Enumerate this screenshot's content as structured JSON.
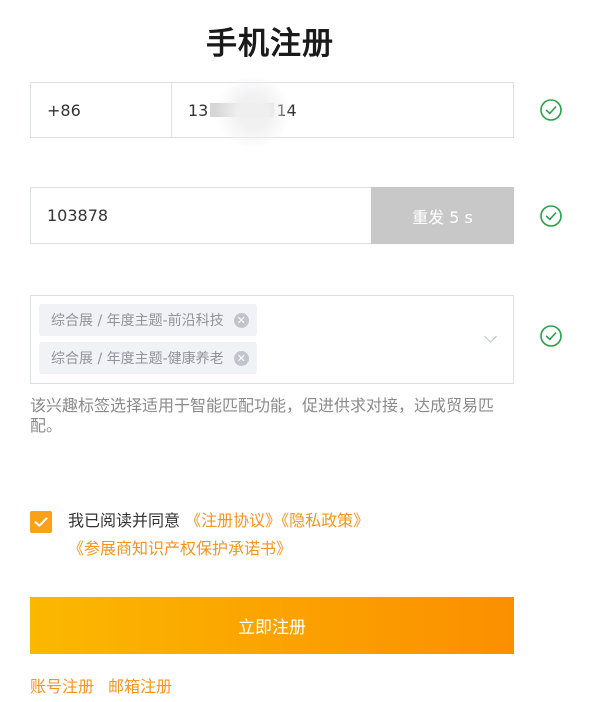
{
  "page": {
    "title": "手机注册"
  },
  "phone": {
    "country_code": "+86",
    "number_prefix": "13",
    "number_suffix": "14"
  },
  "verification": {
    "code_value": "103878",
    "resend_label": "重发 5 s"
  },
  "interests": {
    "tags": [
      "综合展 / 年度主题-前沿科技",
      "综合展 / 年度主题-健康养老"
    ],
    "hint": "该兴趣标签选择适用于智能匹配功能，促进供求对接，达成贸易匹配。"
  },
  "agreement": {
    "checked": true,
    "text": "我已阅读并同意",
    "terms_link": "《注册协议》",
    "privacy_link": "《隐私政策》",
    "exhibitor_link": "《参展商知识产权保护承诺书》"
  },
  "actions": {
    "submit_label": "立即注册",
    "account_register": "账号注册",
    "email_register": "邮箱注册"
  },
  "colors": {
    "accent": "#f6941b",
    "valid_check": "#25a244",
    "disabled_button": "#c8c8c8"
  },
  "icons": {
    "valid": "check-circle-icon",
    "tag_remove": "close-circle-icon",
    "dropdown": "chevron-down-icon",
    "checkbox": "checkmark-icon"
  }
}
